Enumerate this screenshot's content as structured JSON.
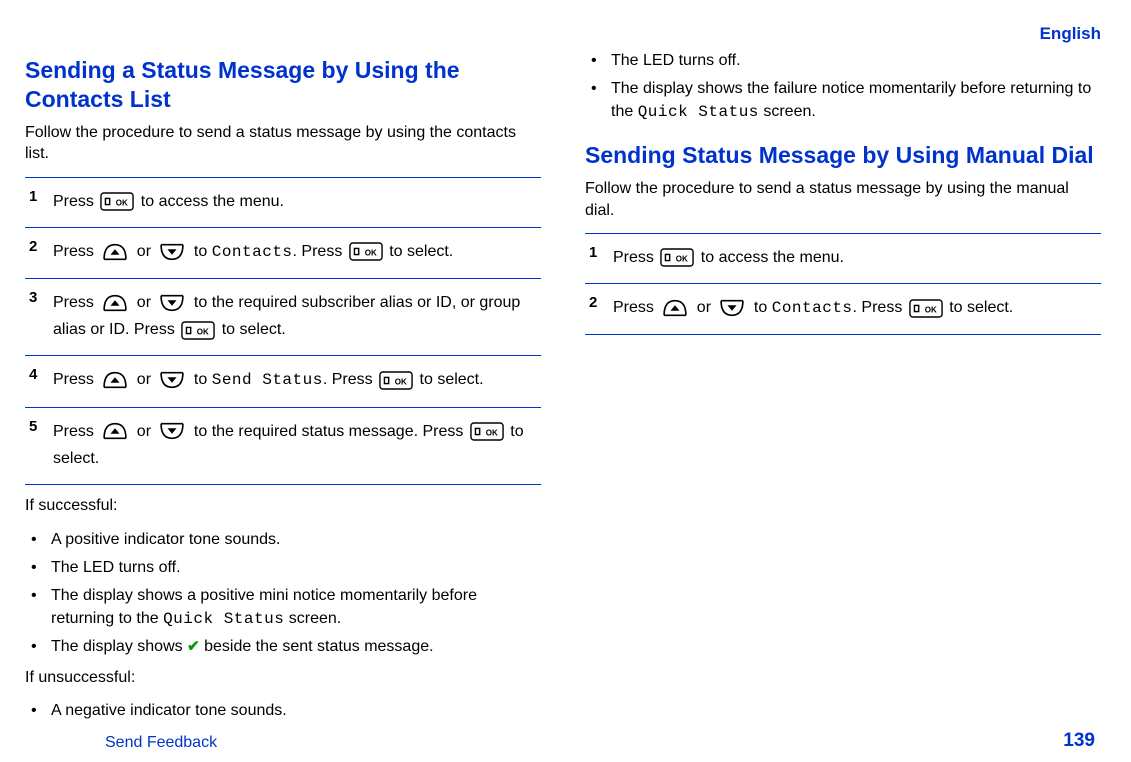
{
  "header": {
    "language": "English"
  },
  "section1": {
    "title": "Sending a Status Message by Using the Contacts List",
    "intro": "Follow the procedure to send a status message by using the contacts list.",
    "steps": {
      "s1": {
        "num": "1",
        "p1": "Press ",
        "p2": " to access the menu."
      },
      "s2": {
        "num": "2",
        "p1": "Press ",
        "p2": " or ",
        "p3": " to ",
        "code": "Contacts",
        "p4": ". Press ",
        "p5": " to select."
      },
      "s3": {
        "num": "3",
        "p1": "Press ",
        "p2": " or ",
        "p3": " to the required subscriber alias or ID, or group alias or ID. Press ",
        "p4": " to select."
      },
      "s4": {
        "num": "4",
        "p1": "Press ",
        "p2": " or ",
        "p3": " to ",
        "code": "Send Status",
        "p4": ". Press ",
        "p5": " to select."
      },
      "s5": {
        "num": "5",
        "p1": "Press ",
        "p2": " or ",
        "p3": " to the required status message. Press ",
        "p4": " to select."
      }
    },
    "if_success_label": "If successful:",
    "success_bullets": {
      "b1": "A positive indicator tone sounds.",
      "b2": "The LED turns off.",
      "b3a": "The display shows a positive mini notice momentarily before returning to the ",
      "b3code": "Quick Status",
      "b3b": " screen.",
      "b4a": "The display shows ",
      "b4b": " beside the sent status message."
    },
    "if_fail_label": "If unsuccessful:",
    "fail_bullets": {
      "b1": "A negative indicator tone sounds.",
      "b2": "The LED turns off.",
      "b3a": "The display shows the failure notice momentarily before returning to the ",
      "b3code": "Quick Status",
      "b3b": " screen."
    }
  },
  "section2": {
    "title": "Sending Status Message by Using Manual Dial",
    "intro": "Follow the procedure to send a status message by using the manual dial.",
    "steps": {
      "s1": {
        "num": "1",
        "p1": "Press ",
        "p2": " to access the menu."
      },
      "s2": {
        "num": "2",
        "p1": "Press ",
        "p2": " or ",
        "p3": " to ",
        "code": "Contacts",
        "p4": ". Press ",
        "p5": " to select."
      }
    }
  },
  "footer": {
    "feedback": "Send Feedback",
    "page": "139"
  },
  "icons": {
    "ok_key": "menu-ok-key",
    "up_key": "up-arrow-key",
    "down_key": "down-arrow-key",
    "check": "✔"
  }
}
